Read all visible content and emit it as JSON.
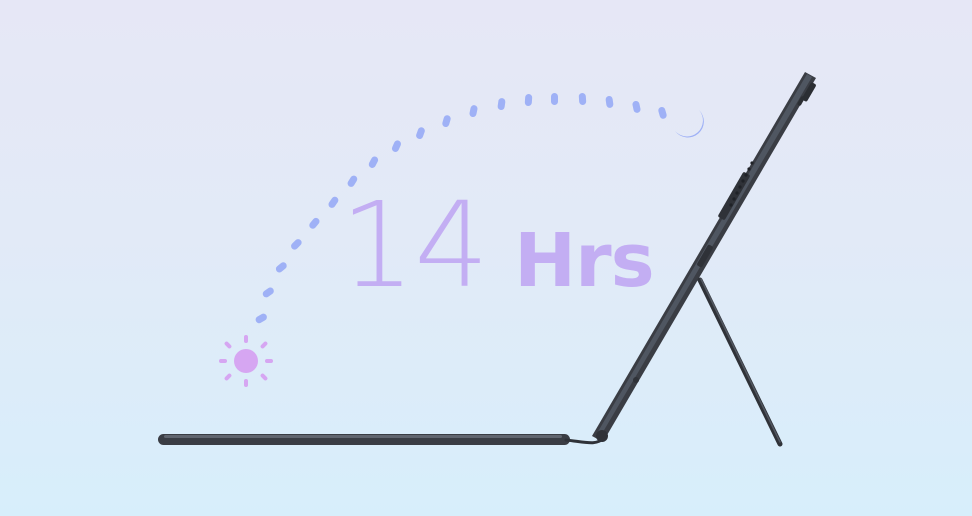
{
  "headline": {
    "number": "14",
    "unit": "Hrs"
  },
  "icons": {
    "start": "sun-icon",
    "end": "moon-icon",
    "device": "tablet-with-keyboard-kickstand"
  },
  "colors": {
    "background_top": "#e6e7f6",
    "background_bottom": "#d7eefb",
    "headline_text": "#c3aef3",
    "arc_dots": "#9fb1f6",
    "sun": "#d6a6f2",
    "moon": "#9fb1f6",
    "device": "#3a3d44"
  }
}
